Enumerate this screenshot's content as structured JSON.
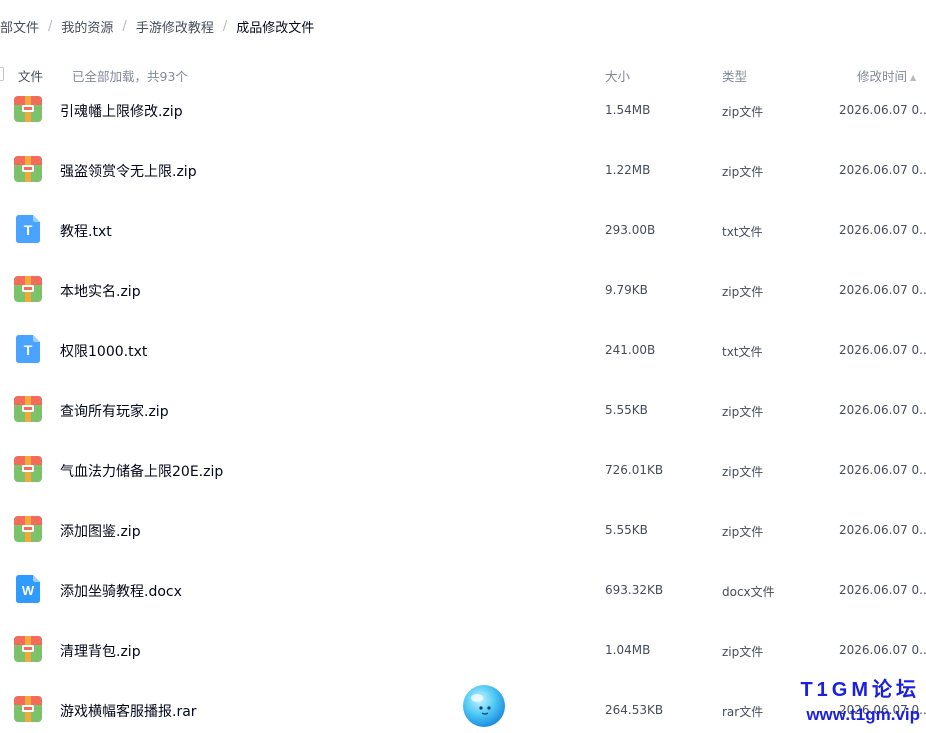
{
  "breadcrumb": [
    {
      "label": "部文件"
    },
    {
      "label": "我的资源"
    },
    {
      "label": "手游修改教程"
    },
    {
      "label": "成品修改文件"
    }
  ],
  "breadcrumb_separator": "/",
  "list_header": {
    "file": "文件",
    "count_text": "已全部加载，共93个",
    "size": "大小",
    "type": "类型",
    "modified": "修改时间"
  },
  "files": [
    {
      "name": "引魂幡上限修改.zip",
      "size": "1.54MB",
      "type": "zip文件",
      "modified": "2026.06.07 0...",
      "icon": "zip-archive-icon"
    },
    {
      "name": "强盗领赏令无上限.zip",
      "size": "1.22MB",
      "type": "zip文件",
      "modified": "2026.06.07 0...",
      "icon": "zip-archive-icon"
    },
    {
      "name": "教程.txt",
      "size": "293.00B",
      "type": "txt文件",
      "modified": "2026.06.07 0...",
      "icon": "text-file-icon"
    },
    {
      "name": "本地实名.zip",
      "size": "9.79KB",
      "type": "zip文件",
      "modified": "2026.06.07 0...",
      "icon": "zip-archive-icon"
    },
    {
      "name": "权限1000.txt",
      "size": "241.00B",
      "type": "txt文件",
      "modified": "2026.06.07 0...",
      "icon": "text-file-icon"
    },
    {
      "name": "查询所有玩家.zip",
      "size": "5.55KB",
      "type": "zip文件",
      "modified": "2026.06.07 0...",
      "icon": "zip-archive-icon"
    },
    {
      "name": "气血法力储备上限20E.zip",
      "size": "726.01KB",
      "type": "zip文件",
      "modified": "2026.06.07 0...",
      "icon": "zip-archive-icon"
    },
    {
      "name": "添加图鉴.zip",
      "size": "5.55KB",
      "type": "zip文件",
      "modified": "2026.06.07 0...",
      "icon": "zip-archive-icon"
    },
    {
      "name": "添加坐骑教程.docx",
      "size": "693.32KB",
      "type": "docx文件",
      "modified": "2026.06.07 0...",
      "icon": "word-doc-icon"
    },
    {
      "name": "清理背包.zip",
      "size": "1.04MB",
      "type": "zip文件",
      "modified": "2026.06.07 0...",
      "icon": "zip-archive-icon"
    },
    {
      "name": "游戏横幅客服播报.rar",
      "size": "264.53KB",
      "type": "rar文件",
      "modified": "2026.06.07 0...",
      "icon": "zip-archive-icon"
    }
  ],
  "watermark": {
    "line1": "T1GM论坛",
    "line2": "www.t1gm.vip"
  },
  "colors": {
    "text_primary": "#03081a",
    "text_secondary": "#454d5a",
    "text_muted": "#818999",
    "watermark": "#1a1fe0",
    "txt_icon": "#4aa3ff",
    "doc_icon": "#2f9bff"
  }
}
